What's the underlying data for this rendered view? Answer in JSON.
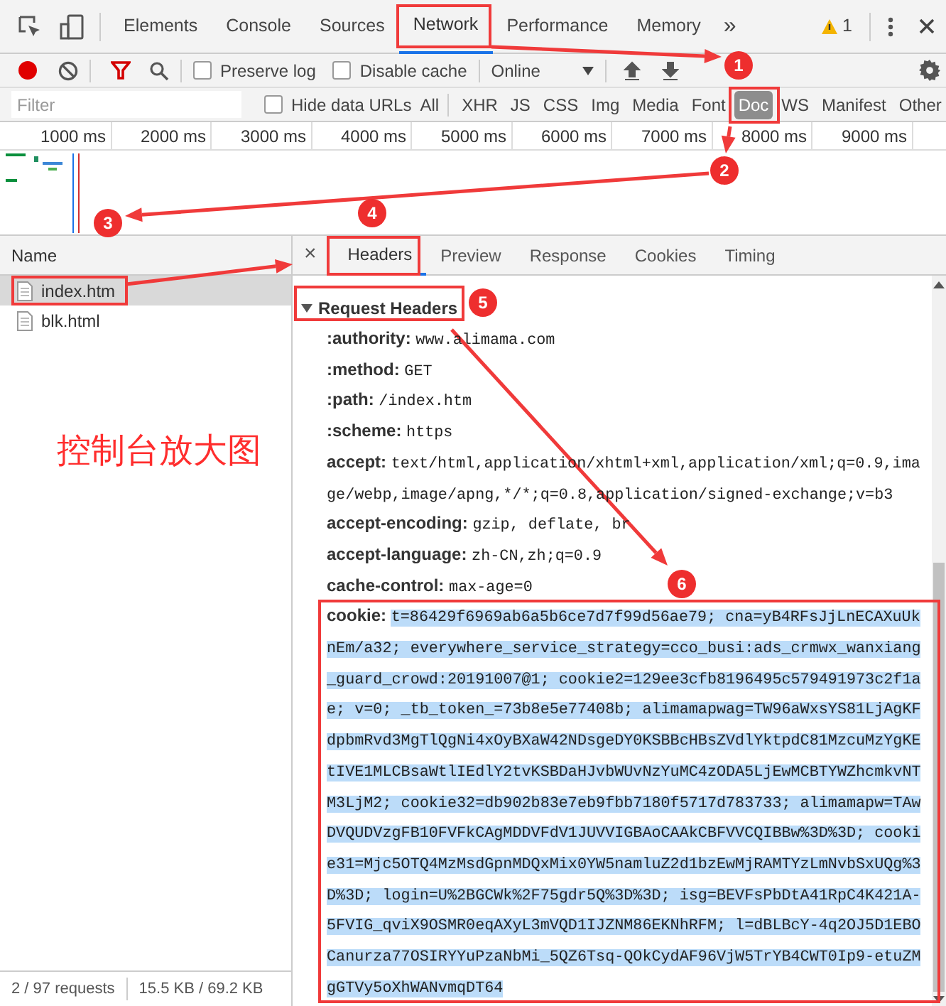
{
  "devtools_tabs": [
    {
      "label": "Elements",
      "selected": false
    },
    {
      "label": "Console",
      "selected": false
    },
    {
      "label": "Sources",
      "selected": false
    },
    {
      "label": "Network",
      "selected": true
    },
    {
      "label": "Performance",
      "selected": false
    },
    {
      "label": "Memory",
      "selected": false
    }
  ],
  "more": "»",
  "warning_count": "1",
  "toolbar": {
    "recording": true,
    "preserve_log": {
      "label": "Preserve log",
      "checked": false
    },
    "disable_cache": {
      "label": "Disable cache",
      "checked": false
    },
    "throttling": "Online"
  },
  "filter": {
    "placeholder": "Filter",
    "hide_data_urls": {
      "label": "Hide data URLs",
      "checked": false
    },
    "types": [
      {
        "label": "All",
        "selected": false
      },
      {
        "label": "XHR",
        "selected": false
      },
      {
        "label": "JS",
        "selected": false
      },
      {
        "label": "CSS",
        "selected": false
      },
      {
        "label": "Img",
        "selected": false
      },
      {
        "label": "Media",
        "selected": false
      },
      {
        "label": "Font",
        "selected": false
      },
      {
        "label": "Doc",
        "selected": true
      },
      {
        "label": "WS",
        "selected": false
      },
      {
        "label": "Manifest",
        "selected": false
      },
      {
        "label": "Other",
        "selected": false
      }
    ]
  },
  "timeline": {
    "ticks": [
      "1000 ms",
      "2000 ms",
      "3000 ms",
      "4000 ms",
      "5000 ms",
      "6000 ms",
      "7000 ms",
      "8000 ms",
      "9000 ms"
    ]
  },
  "requests": {
    "column": "Name",
    "rows": [
      {
        "name": "index.htm",
        "selected": true
      },
      {
        "name": "blk.html",
        "selected": false
      }
    ]
  },
  "status_bar": [
    "2 / 97 requests",
    "15.5 KB / 69.2 KB"
  ],
  "detail_tabs": [
    {
      "label": "Headers",
      "selected": true
    },
    {
      "label": "Preview",
      "selected": false
    },
    {
      "label": "Response",
      "selected": false
    },
    {
      "label": "Cookies",
      "selected": false
    },
    {
      "label": "Timing",
      "selected": false
    }
  ],
  "close": "×",
  "section": {
    "title": "Request Headers",
    "expanded": true,
    "headers": [
      {
        "name": ":authority:",
        "value": "www.alimama.com",
        "selected": false
      },
      {
        "name": ":method:",
        "value": "GET",
        "selected": false
      },
      {
        "name": ":path:",
        "value": "/index.htm",
        "selected": false
      },
      {
        "name": ":scheme:",
        "value": "https",
        "selected": false
      },
      {
        "name": "accept:",
        "value": "text/html,application/xhtml+xml,application/xml;q=0.9,image/webp,image/apng,*/*;q=0.8,application/signed-exchange;v=b3",
        "selected": false
      },
      {
        "name": "accept-encoding:",
        "value": "gzip, deflate, br",
        "selected": false
      },
      {
        "name": "accept-language:",
        "value": "zh-CN,zh;q=0.9",
        "selected": false
      },
      {
        "name": "cache-control:",
        "value": "max-age=0",
        "selected": false
      },
      {
        "name": "cookie:",
        "value": "t=86429f6969ab6a5b6ce7d7f99d56ae79; cna=yB4RFsJjLnECAXuUknEm/a32; everywhere_service_strategy=cco_busi:ads_crmwx_wanxiang_guard_crowd:20191007@1; cookie2=129ee3cfb8196495c579491973c2f1ae; v=0; _tb_token_=73b8e5e77408b; alimamapwag=TW96aWxsYS81LjAgKFdpbmRvd3MgTlQgNi4xOyBXaW42NDsgeDY0KSBBcHBsZVdlYktpdC81MzcuMzYgKEtIVE1MLCBsaWtlIEdlY2tvKSBDaHJvbWUvNzYuMC4zODA5LjEwMCBTYWZhcmkvNTM3LjM2; cookie32=db902b83e7eb9fbb7180f5717d783733; alimamapw=TAwDVQUDVzgFB10FVFkCAgMDDVFdV1JUVVIGBAoCAAkCBFVVCQIBBw%3D%3D; cookie31=Mjc5OTQ4MzMsdGpnMDQxMix0YW5namluZ2d1bzEwMjRAMTYzLmNvbSxUQg%3D%3D; login=U%2BGCWk%2F75gdr5Q%3D%3D; isg=BEVFsPbDtA41RpC4K421A-5FVIG_qviX9OSMR0eqAXyL3mVQD1IJZNM86EKNhRFM; l=dBLBcY-4q2OJ5D1EBOCanurza77OSIRYYuPzaNbMi_5QZ6Tsq-QOkCydAF96VjW5TrYB4CWT0Ip9-etuZMgGTVy5oXhWANvmqDT64",
        "selected": true
      }
    ]
  },
  "annotations": {
    "caption": "控制台放大图",
    "markers": [
      "1",
      "2",
      "3",
      "4",
      "5",
      "6"
    ]
  }
}
